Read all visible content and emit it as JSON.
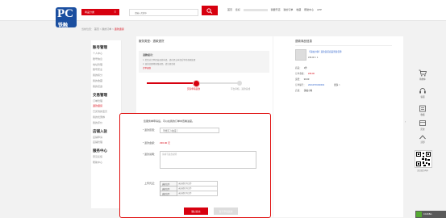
{
  "header": {
    "logo_letters": "PC",
    "logo_text": "铁融",
    "category_label": "商品分类",
    "search_placeholder": "请输入关键字",
    "links": [
      "首页",
      "您好",
      "我要开店",
      "我的订单",
      "收藏",
      "帮助中心",
      "APP"
    ]
  },
  "breadcrumb": {
    "home": "当前位置：",
    "mid": "首页 > 我的订单 >",
    "current": "退款退货"
  },
  "sidebar": [
    {
      "type": "section",
      "label": "账号管理"
    },
    {
      "type": "item",
      "label": "个人中心"
    },
    {
      "type": "item",
      "label": "账号信息"
    },
    {
      "type": "item",
      "label": "地址管理"
    },
    {
      "type": "item",
      "label": "账号安全"
    },
    {
      "type": "item",
      "label": "我的积分"
    },
    {
      "type": "item",
      "label": "我的收藏"
    },
    {
      "type": "item",
      "label": "我的足迹"
    },
    {
      "type": "section",
      "label": "交易管理"
    },
    {
      "type": "item",
      "label": "订单管理"
    },
    {
      "type": "item",
      "label": "退款退货",
      "active": true
    },
    {
      "type": "item",
      "label": "已买到的宝贝"
    },
    {
      "type": "item",
      "label": "我的优惠券"
    },
    {
      "type": "item",
      "label": "我的评价"
    },
    {
      "type": "section",
      "label": "店铺入驻"
    },
    {
      "type": "item",
      "label": "店铺申请"
    },
    {
      "type": "item",
      "label": "店铺管理"
    },
    {
      "type": "section",
      "label": "服务中心"
    },
    {
      "type": "item",
      "label": "意见反馈"
    },
    {
      "type": "item",
      "label": "帮助中心"
    }
  ],
  "main": {
    "title": "服务类型：退款退货",
    "notice_title": "退款提示：",
    "notice_lines": [
      "1. 若您对订单提出退款申请，请在提交申请后等待商家处理",
      "2. 退款金额将原路退回，请注意查收"
    ],
    "notice_highlight": "订单退款",
    "progress_fraction": 0.5,
    "step1": "买家申请退款",
    "step2": "平台审核，退款完成",
    "form_intro": "您服务单申请后，可以在我的订单中查看进度。",
    "reason_label": "* 退款原因：",
    "reason_value": "不想买了/拍错了",
    "amount_label": "* 退款金额：",
    "amount_value": "¥36.00 元",
    "desc_label": "* 退款说明：",
    "desc_placeholder": "请填写退款说明",
    "upload_label": "上传凭证：",
    "upload_button": "选择文件",
    "upload_status": "未选择任何文件",
    "submit_label": "确认提交",
    "later_label": "暂不申请退款"
  },
  "rpanel": {
    "title": "退款商品信息",
    "product_name": "【铁融小象】退款退货商品测试名称",
    "product_price": "¥36.00 × 1",
    "rows": [
      {
        "k": "商品：",
        "v": "1件"
      },
      {
        "k": "订单金额：",
        "v": "¥36.00"
      },
      {
        "k": "运费：",
        "v": "¥0.00"
      },
      {
        "k": "订单编号：",
        "v": "20210709160932",
        "extra": "更多 >"
      },
      {
        "k": "店铺：",
        "v": "铁融小象"
      }
    ]
  },
  "side": {
    "items": [
      "购物车",
      "客服",
      "收藏",
      "足迹",
      "顶部"
    ],
    "qr_label": "关注官方App"
  },
  "status": {
    "text": "0.10KB/s"
  },
  "colors": {
    "brand_red": "#d7000f",
    "brand_blue": "#1b4fa0"
  }
}
